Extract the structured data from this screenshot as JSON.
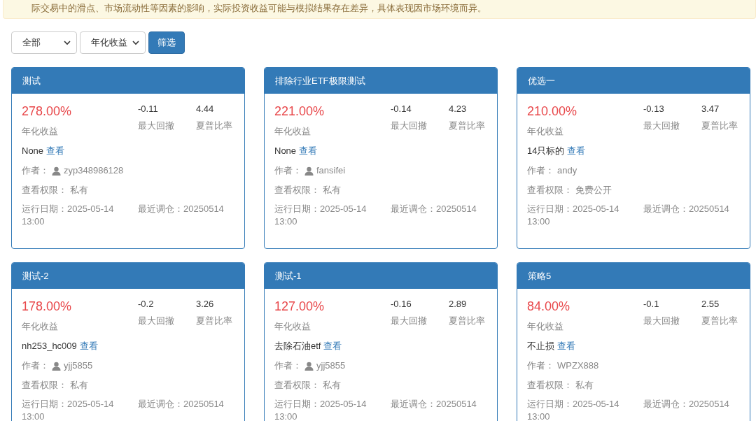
{
  "notice": "际交易中的滑点、市场流动性等因素的影响，实际投资收益可能与模拟结果存在差异，具体表现因市场环境而异。",
  "filters": {
    "selects": [
      "全部",
      "年化收益"
    ],
    "button": "筛选"
  },
  "cards": [
    {
      "title": "测试",
      "annual": "278.00%",
      "annual_label": "年化收益",
      "drawdown": "-0.11",
      "drawdown_label": "最大回撤",
      "sharpe": "4.44",
      "sharpe_label": "夏普比率",
      "desc": "None",
      "link": "查看",
      "author_label": "作者：",
      "author_icon": true,
      "author": "zyp348986128",
      "perm_label": "查看权限：",
      "perm": "私有",
      "run_label": "运行日期：",
      "run": "2025-05-14 13:00",
      "rebalance_label": "最近调仓：",
      "rebalance": "20250514"
    },
    {
      "title": "排除行业ETF极限测试",
      "annual": "221.00%",
      "annual_label": "年化收益",
      "drawdown": "-0.14",
      "drawdown_label": "最大回撤",
      "sharpe": "4.23",
      "sharpe_label": "夏普比率",
      "desc": "None",
      "link": "查看",
      "author_label": "作者：",
      "author_icon": true,
      "author": "fansifei",
      "perm_label": "查看权限：",
      "perm": "私有",
      "run_label": "运行日期：",
      "run": "2025-05-14 13:00",
      "rebalance_label": "最近调仓：",
      "rebalance": "20250514"
    },
    {
      "title": "优选一",
      "annual": "210.00%",
      "annual_label": "年化收益",
      "drawdown": "-0.13",
      "drawdown_label": "最大回撤",
      "sharpe": "3.47",
      "sharpe_label": "夏普比率",
      "desc": "14只标的",
      "link": "查看",
      "author_label": "作者：",
      "author_icon": false,
      "author": "andy",
      "perm_label": "查看权限：",
      "perm": "免费公开",
      "run_label": "运行日期：",
      "run": "2025-05-14 13:00",
      "rebalance_label": "最近调仓：",
      "rebalance": "20250514"
    },
    {
      "title": "测试-2",
      "annual": "178.00%",
      "annual_label": "年化收益",
      "drawdown": "-0.2",
      "drawdown_label": "最大回撤",
      "sharpe": "3.26",
      "sharpe_label": "夏普比率",
      "desc": "nh253_hc009",
      "link": "查看",
      "author_label": "作者：",
      "author_icon": true,
      "author": "yjj5855",
      "perm_label": "查看权限：",
      "perm": "私有",
      "run_label": "运行日期：",
      "run": "2025-05-14 13:00",
      "rebalance_label": "最近调仓：",
      "rebalance": "20250514"
    },
    {
      "title": "测试-1",
      "annual": "127.00%",
      "annual_label": "年化收益",
      "drawdown": "-0.16",
      "drawdown_label": "最大回撤",
      "sharpe": "2.89",
      "sharpe_label": "夏普比率",
      "desc": "去除石油etf",
      "link": "查看",
      "author_label": "作者：",
      "author_icon": true,
      "author": "yjj5855",
      "perm_label": "查看权限：",
      "perm": "私有",
      "run_label": "运行日期：",
      "run": "2025-05-14 13:00",
      "rebalance_label": "最近调仓：",
      "rebalance": "20250514"
    },
    {
      "title": "策略5",
      "annual": "84.00%",
      "annual_label": "年化收益",
      "drawdown": "-0.1",
      "drawdown_label": "最大回撤",
      "sharpe": "2.55",
      "sharpe_label": "夏普比率",
      "desc": "不止损",
      "link": "查看",
      "author_label": "作者：",
      "author_icon": false,
      "author": "WPZX888",
      "perm_label": "查看权限：",
      "perm": "私有",
      "run_label": "运行日期：",
      "run": "2025-05-14 13:00",
      "rebalance_label": "最近调仓：",
      "rebalance": "20250514"
    }
  ]
}
